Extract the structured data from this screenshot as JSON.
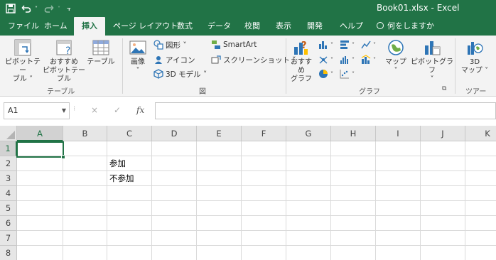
{
  "titlebar": {
    "title": "Book01.xlsx  -  Excel",
    "qa_save_icon": "save-icon",
    "qa_undo_icon": "undo-icon",
    "qa_redo_icon": "redo-icon",
    "qa_customize_icon": "customize-icon",
    "color": "#217346"
  },
  "tabs": [
    {
      "label": "ファイル"
    },
    {
      "label": "ホーム"
    },
    {
      "label": "挿入",
      "active": true
    },
    {
      "label": "ページ レイアウト"
    },
    {
      "label": "数式"
    },
    {
      "label": "データ"
    },
    {
      "label": "校閲"
    },
    {
      "label": "表示"
    },
    {
      "label": "開発"
    },
    {
      "label": "ヘルプ"
    },
    {
      "label": "何をしますか"
    }
  ],
  "ribbon": {
    "table_group": {
      "pivot_table": "ピボットテー\nブル ˅",
      "recommended_pivot": "おすすめ\nピボットテーブル",
      "table": "テーブル",
      "label": "テーブル"
    },
    "illustrations_group": {
      "pictures": "画像\n˅",
      "shapes": "図形 ˅",
      "icons": "アイコン",
      "models_3d": "3D モデル  ˅",
      "smartart": "SmartArt",
      "screenshot": "スクリーンショット ˅",
      "label": "図",
      "more_icon": "expand-icon"
    },
    "charts_group": {
      "recommended_charts": "おすすめ\nグラフ",
      "maps": "マップ\n˅",
      "pivot_chart": "ピボットグラフ\n˅",
      "label": "グラフ",
      "launcher_icon": "dialog-launcher-icon"
    },
    "tours_group": {
      "map_3d": "3D\nマップ ˅",
      "label": "ツアー"
    }
  },
  "formula_bar": {
    "name_box": "A1",
    "cancel_symbol": "×",
    "enter_symbol": "✓",
    "fx_symbol": "fx",
    "formula": ""
  },
  "grid": {
    "columns": [
      "A",
      "B",
      "C",
      "D",
      "E",
      "F",
      "G",
      "H",
      "I",
      "J",
      "K"
    ],
    "rows": [
      "1",
      "2",
      "3",
      "4",
      "5",
      "6",
      "7",
      "8"
    ],
    "active_cell": "A1",
    "cells": {
      "C2": "参加",
      "C3": "不参加"
    }
  }
}
